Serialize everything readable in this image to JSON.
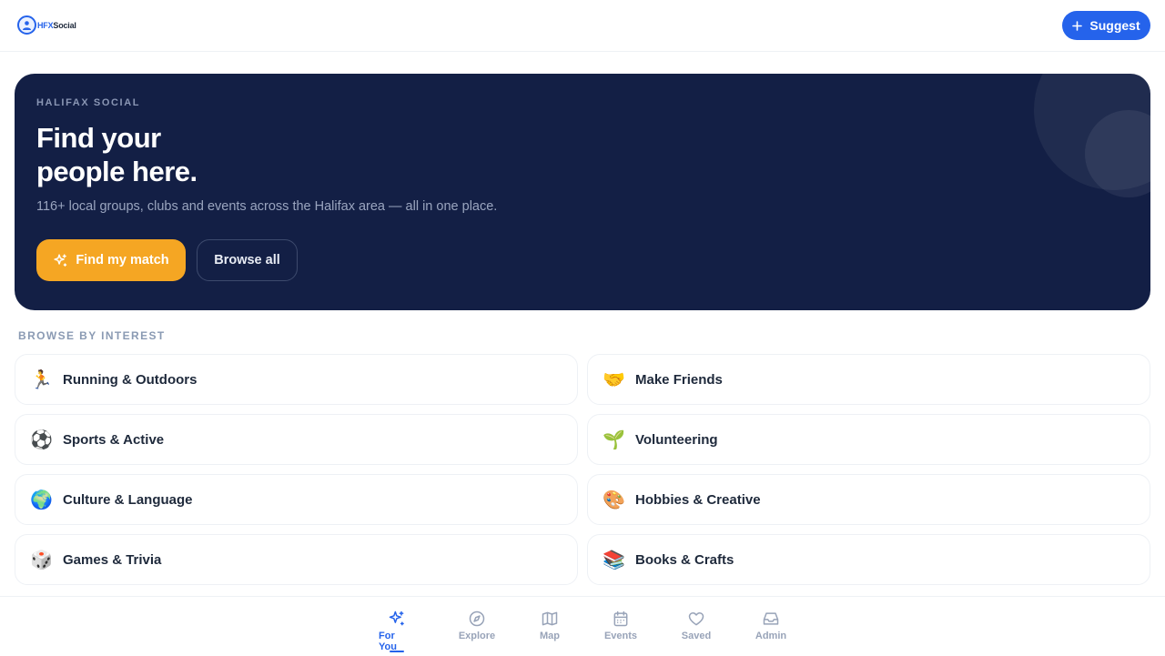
{
  "header": {
    "logo_text_accent": "HFX",
    "logo_text_main": "Social",
    "suggest_label": "Suggest"
  },
  "hero": {
    "eyebrow": "HALIFAX SOCIAL",
    "title_line1": "Find your",
    "title_line2": "people here.",
    "subtitle": "116+ local groups, clubs and events across the Halifax area — all in one place.",
    "primary_button": "Find my match",
    "secondary_button": "Browse all"
  },
  "interests": {
    "section_label": "BROWSE BY INTEREST",
    "items": [
      {
        "emoji": "🏃",
        "label": "Running & Outdoors"
      },
      {
        "emoji": "🤝",
        "label": "Make Friends"
      },
      {
        "emoji": "⚽",
        "label": "Sports & Active"
      },
      {
        "emoji": "🌱",
        "label": "Volunteering"
      },
      {
        "emoji": "🌍",
        "label": "Culture & Language"
      },
      {
        "emoji": "🎨",
        "label": "Hobbies & Creative"
      },
      {
        "emoji": "🎲",
        "label": "Games & Trivia"
      },
      {
        "emoji": "📚",
        "label": "Books & Crafts"
      }
    ]
  },
  "nav": {
    "items": [
      {
        "label": "For You",
        "icon": "sparkles-icon",
        "active": true
      },
      {
        "label": "Explore",
        "icon": "compass-icon"
      },
      {
        "label": "Map",
        "icon": "map-icon"
      },
      {
        "label": "Events",
        "icon": "calendar-icon"
      },
      {
        "label": "Saved",
        "icon": "heart-icon"
      },
      {
        "label": "Admin",
        "icon": "inbox-icon"
      }
    ]
  },
  "colors": {
    "accent": "#2563eb",
    "hero_bg": "#131f45",
    "primary_cta": "#f5a623"
  }
}
